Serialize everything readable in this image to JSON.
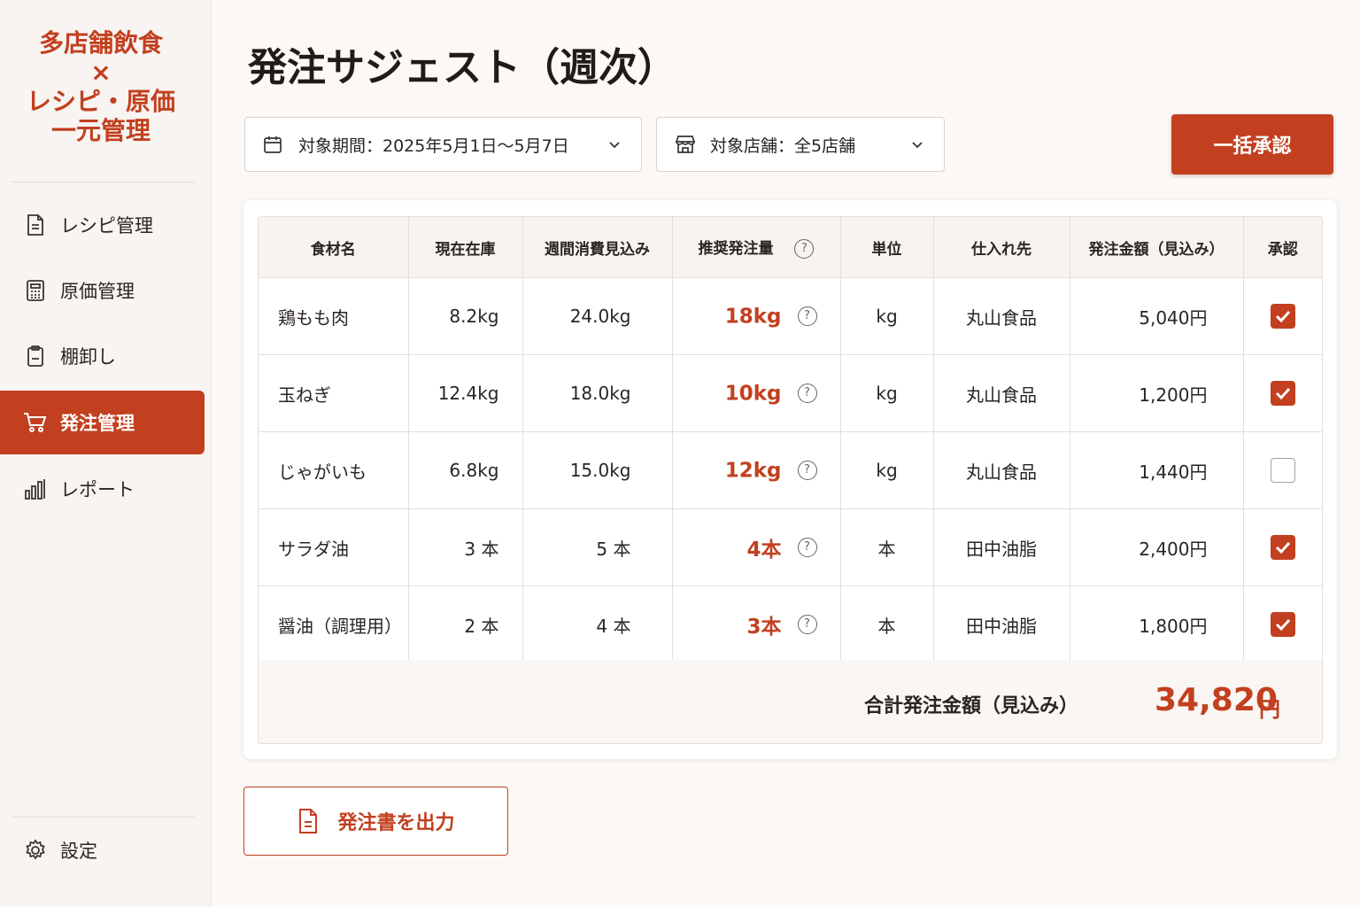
{
  "brand": {
    "line1": "多店舗飲食",
    "line2": "×",
    "line3": "レシピ・原価",
    "line4": "一元管理"
  },
  "sidebar": {
    "items": [
      {
        "label": "レシピ管理",
        "icon": "document-icon"
      },
      {
        "label": "原価管理",
        "icon": "calculator-icon"
      },
      {
        "label": "棚卸し",
        "icon": "clipboard-icon"
      },
      {
        "label": "発注管理",
        "icon": "cart-icon",
        "active": true
      },
      {
        "label": "レポート",
        "icon": "bar-chart-icon"
      }
    ],
    "settings_label": "設定"
  },
  "page": {
    "title": "発注サジェスト（週次）"
  },
  "filters": {
    "period": "対象期間：2025年5月1日〜5月7日",
    "stores": "対象店舗：全5店舗"
  },
  "actions": {
    "bulk_approve": "一括承認",
    "export": "発注書を出力"
  },
  "table": {
    "headers": [
      "食材名",
      "現在在庫",
      "週間消費見込み",
      "推奨発注量",
      "単位",
      "仕入れ先",
      "発注金額（見込み）",
      "承認"
    ],
    "rows": [
      {
        "name": "鶏もも肉",
        "stock": "8.2kg",
        "weekly": "24.0kg",
        "recommended": "18kg",
        "unit": "kg",
        "supplier": "丸山食品",
        "amount": "5,040円",
        "approved": true
      },
      {
        "name": "玉ねぎ",
        "stock": "12.4kg",
        "weekly": "18.0kg",
        "recommended": "10kg",
        "unit": "kg",
        "supplier": "丸山食品",
        "amount": "1,200円",
        "approved": true
      },
      {
        "name": "じゃがいも",
        "stock": "6.8kg",
        "weekly": "15.0kg",
        "recommended": "12kg",
        "unit": "kg",
        "supplier": "丸山食品",
        "amount": "1,440円",
        "approved": false
      },
      {
        "name": "サラダ油",
        "stock": "3 本",
        "weekly": "5 本",
        "recommended": "4本",
        "unit": "本",
        "supplier": "田中油脂",
        "amount": "2,400円",
        "approved": true
      },
      {
        "name": "醤油（調理用）",
        "stock": "2 本",
        "weekly": "4 本",
        "recommended": "3本",
        "unit": "本",
        "supplier": "田中油脂",
        "amount": "1,800円",
        "approved": true
      }
    ],
    "total_label": "合計発注金額（見込み）",
    "total_amount": "34,820",
    "total_unit": "円"
  },
  "colors": {
    "accent": "#c2401f",
    "background": "#fbf8f5"
  }
}
